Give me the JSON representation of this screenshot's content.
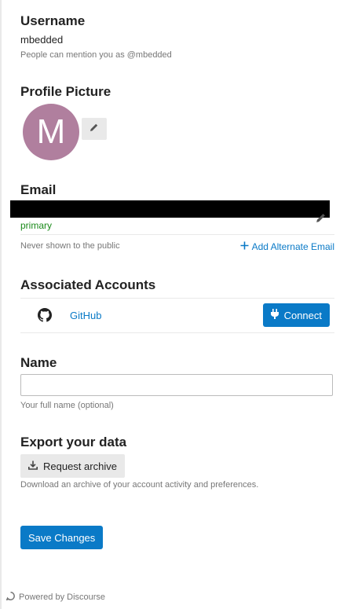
{
  "username": {
    "title": "Username",
    "value": "mbedded",
    "note": "People can mention you as @mbedded"
  },
  "profile_picture": {
    "title": "Profile Picture",
    "avatar_letter": "M",
    "avatar_color": "#b07f9e",
    "edit_icon": "pencil-icon"
  },
  "email": {
    "title": "Email",
    "primary_label": "primary",
    "note": "Never shown to the public",
    "add_alternate": "Add Alternate Email",
    "edit_icon": "pencil-icon"
  },
  "associated_accounts": {
    "title": "Associated Accounts",
    "provider": "GitHub",
    "provider_icon": "github-icon",
    "connect_label": "Connect",
    "connect_icon": "plug-icon"
  },
  "name": {
    "title": "Name",
    "value": "",
    "note": "Your full name (optional)"
  },
  "export": {
    "title": "Export your data",
    "request_label": "Request archive",
    "request_icon": "download-icon",
    "note": "Download an archive of your account activity and preferences."
  },
  "save_label": "Save Changes",
  "footer": {
    "powered_by": "Powered by Discourse",
    "icon": "discourse-icon"
  },
  "colors": {
    "accent": "#0a7ac7",
    "primary_label": "#1a8a1a",
    "muted": "#777777"
  }
}
